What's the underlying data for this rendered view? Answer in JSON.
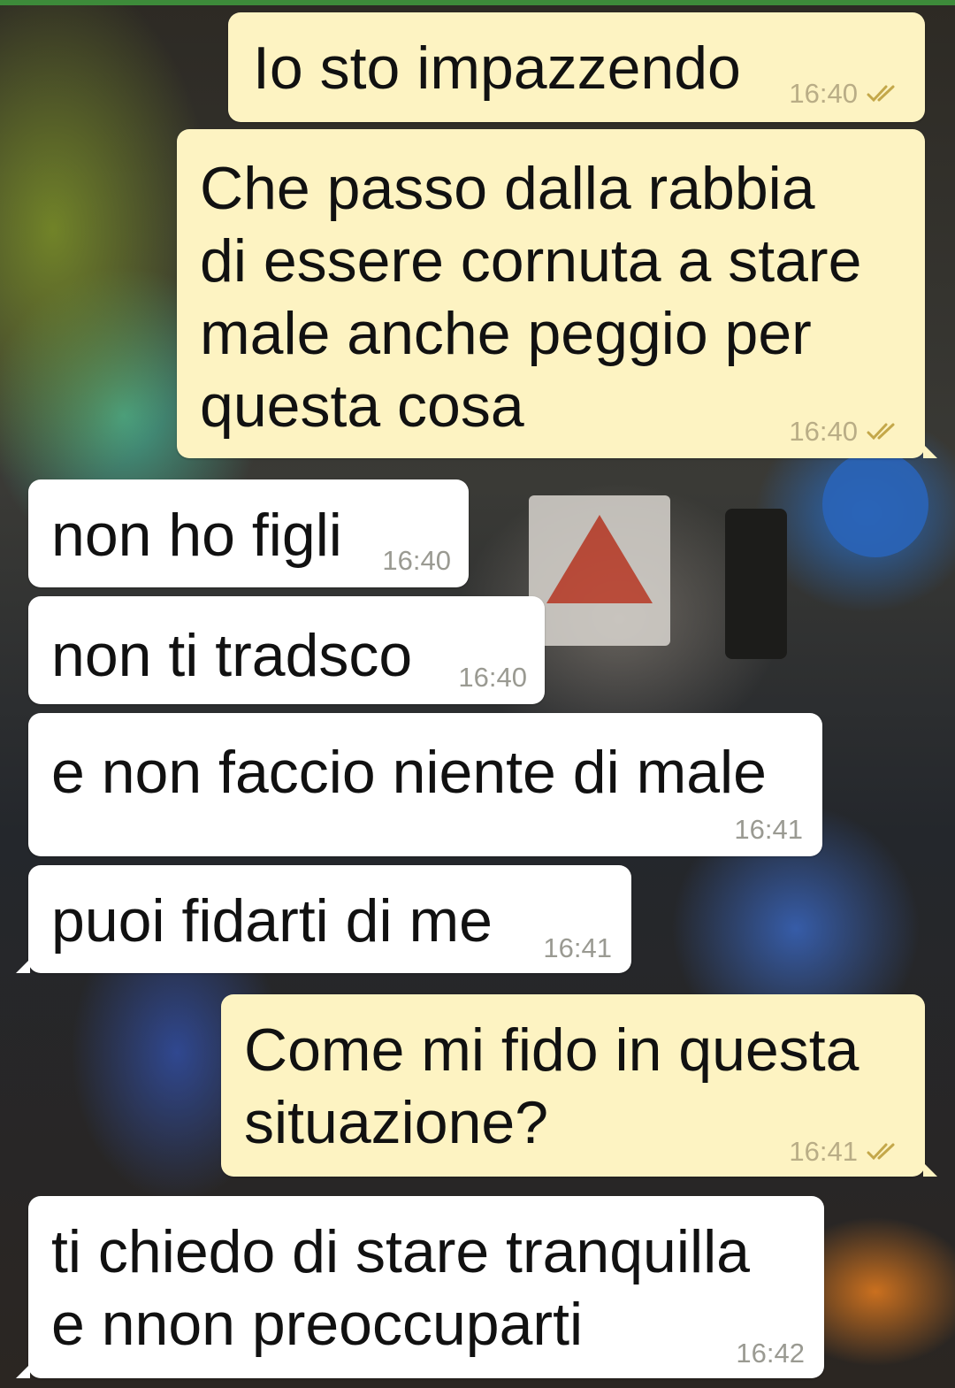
{
  "chat": {
    "messages": [
      {
        "direction": "outgoing",
        "text": "Io sto impazzendo",
        "time": "16:40",
        "status_icon": "double-check-icon"
      },
      {
        "direction": "outgoing",
        "text": "Che passo dalla rabbia\ndi essere cornuta a stare\nmale anche peggio per\nquesta cosa",
        "time": "16:40",
        "status_icon": "double-check-icon"
      },
      {
        "direction": "incoming",
        "text": "non ho figli",
        "time": "16:40"
      },
      {
        "direction": "incoming",
        "text": "non ti tradsco",
        "time": "16:40"
      },
      {
        "direction": "incoming",
        "text": "e non faccio niente di male",
        "time": "16:41"
      },
      {
        "direction": "incoming",
        "text": "puoi fidarti di me",
        "time": "16:41"
      },
      {
        "direction": "outgoing",
        "text": "Come mi fido in questa\nsituazione?",
        "time": "16:41",
        "status_icon": "double-check-icon"
      },
      {
        "direction": "incoming",
        "text": "ti chiedo di stare tranquilla\ne nnon preoccuparti",
        "time": "16:42"
      }
    ]
  },
  "colors": {
    "outgoing_bubble": "#fdf3c2",
    "incoming_bubble": "#ffffff",
    "timestamp_outgoing": "#b9ad86",
    "timestamp_incoming": "#9a9a92",
    "tick_color": "#c4a84a",
    "top_strip": "#3d8b3a"
  }
}
